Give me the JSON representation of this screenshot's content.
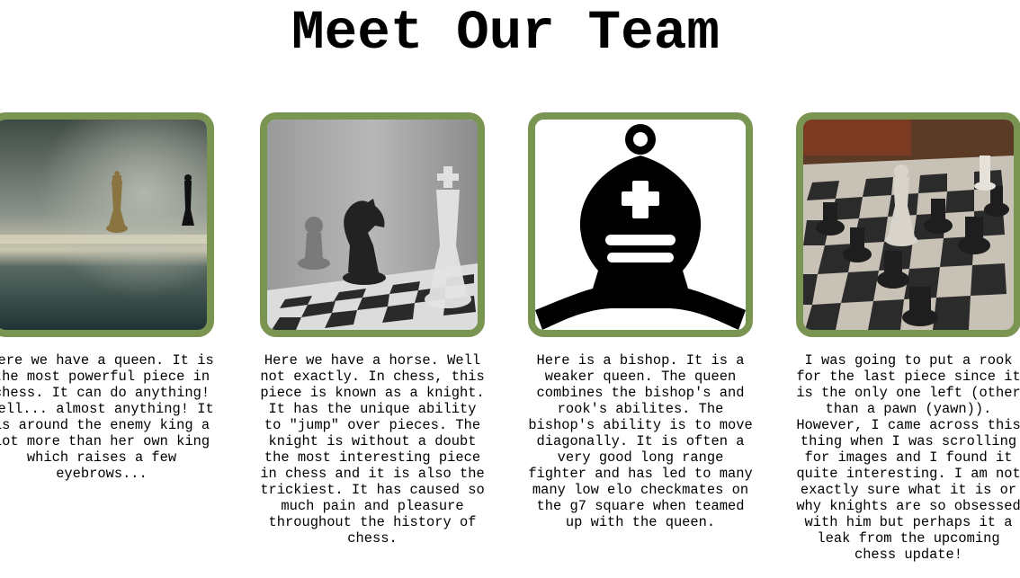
{
  "page": {
    "title": "Meet Our Team"
  },
  "colors": {
    "frame_border": "#7a9552",
    "background": "#ffffff",
    "text": "#000000"
  },
  "team": [
    {
      "image": "queen-photo",
      "caption": "Here we have a queen. It is the most powerful piece in chess. It can do anything! Well... almost anything! It is around the enemy king a lot more than her own king which raises a few eyebrows..."
    },
    {
      "image": "knight-photo",
      "caption": "Here we have a horse. Well not exactly. In chess, this piece is known as a knight. It has the unique ability to \"jump\" over pieces. The knight is without a doubt the most interesting piece in chess and it is also the trickiest. It has caused so much pain and pleasure throughout the history of chess."
    },
    {
      "image": "bishop-icon",
      "caption": "Here is a bishop. It is a weaker queen. The queen combines the bishop's and rook's abilites. The bishop's ability is to move diagonally. It is often a very good long range fighter and has led to many many low elo checkmates on the g7 square when teamed up with the queen."
    },
    {
      "image": "chessboard-photo",
      "caption": "I was going to put a rook for the last piece since it is the only one left (other than a pawn (yawn)). However, I came across this thing when I was scrolling for images and I found it quite interesting. I am not exactly sure what it is or why knights are so obsessed with him but perhaps it a leak from the upcoming chess update!"
    }
  ]
}
